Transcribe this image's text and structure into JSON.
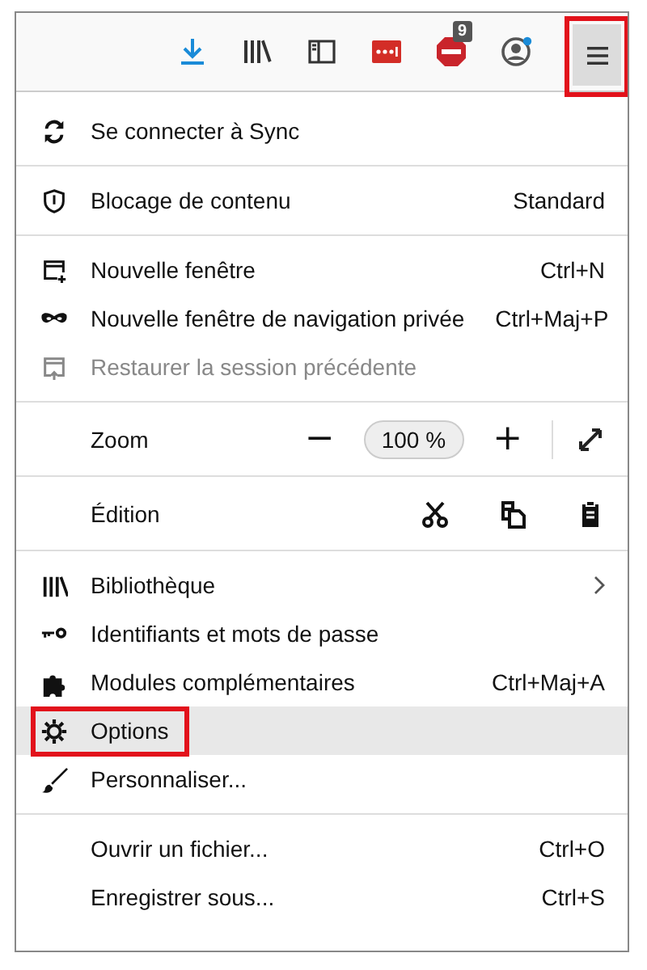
{
  "toolbar": {
    "buttons": [
      {
        "kind": "download"
      },
      {
        "kind": "library"
      },
      {
        "kind": "sidebar"
      },
      {
        "kind": "password"
      },
      {
        "kind": "adblock",
        "badge": "9"
      },
      {
        "kind": "account"
      },
      {
        "kind": "menu",
        "selected": true,
        "annotated": true
      }
    ]
  },
  "menu": {
    "sections": [
      {
        "items": [
          {
            "kind": "item",
            "label": "Se connecter à Sync",
            "disabled": false,
            "hovered": false,
            "annotated": false,
            "submenu": false
          }
        ]
      },
      {
        "items": [
          {
            "kind": "item",
            "label": "Blocage de contenu",
            "shortcut": "Standard",
            "disabled": false,
            "hovered": false,
            "annotated": false,
            "submenu": false
          }
        ]
      },
      {
        "items": [
          {
            "kind": "item",
            "label": "Nouvelle fenêtre",
            "shortcut": "Ctrl+N",
            "disabled": false,
            "hovered": false,
            "annotated": false,
            "submenu": false
          },
          {
            "kind": "item",
            "label": "Nouvelle fenêtre de navigation privée",
            "shortcut": "Ctrl+Maj+P",
            "disabled": false,
            "hovered": false,
            "annotated": false,
            "submenu": false
          },
          {
            "kind": "item",
            "label": "Restaurer la session précédente",
            "disabled": true,
            "hovered": false,
            "annotated": false,
            "submenu": false
          }
        ]
      },
      {
        "items": [
          {
            "kind": "zoom",
            "label": "Zoom",
            "minus": "−",
            "value": "100 %",
            "plus": "+"
          }
        ]
      },
      {
        "items": [
          {
            "kind": "edit",
            "label": "Édition"
          }
        ]
      },
      {
        "items": [
          {
            "kind": "item",
            "label": "Bibliothèque",
            "disabled": false,
            "hovered": false,
            "annotated": false,
            "submenu": true
          },
          {
            "kind": "item",
            "label": "Identifiants et mots de passe",
            "disabled": false,
            "hovered": false,
            "annotated": false,
            "submenu": false
          },
          {
            "kind": "item",
            "label": "Modules complémentaires",
            "shortcut": "Ctrl+Maj+A",
            "disabled": false,
            "hovered": false,
            "annotated": false,
            "submenu": false
          },
          {
            "kind": "item",
            "label": "Options",
            "disabled": false,
            "hovered": true,
            "annotated": true,
            "submenu": false
          },
          {
            "kind": "item",
            "label": "Personnaliser...",
            "disabled": false,
            "hovered": false,
            "annotated": false,
            "submenu": false
          }
        ]
      },
      {
        "items": [
          {
            "kind": "item",
            "label": "Ouvrir un fichier...",
            "shortcut": "Ctrl+O",
            "disabled": false,
            "hovered": false,
            "annotated": false,
            "submenu": false
          },
          {
            "kind": "item",
            "label": "Enregistrer sous...",
            "shortcut": "Ctrl+S",
            "disabled": false,
            "hovered": false,
            "annotated": false,
            "submenu": false
          }
        ]
      }
    ]
  }
}
